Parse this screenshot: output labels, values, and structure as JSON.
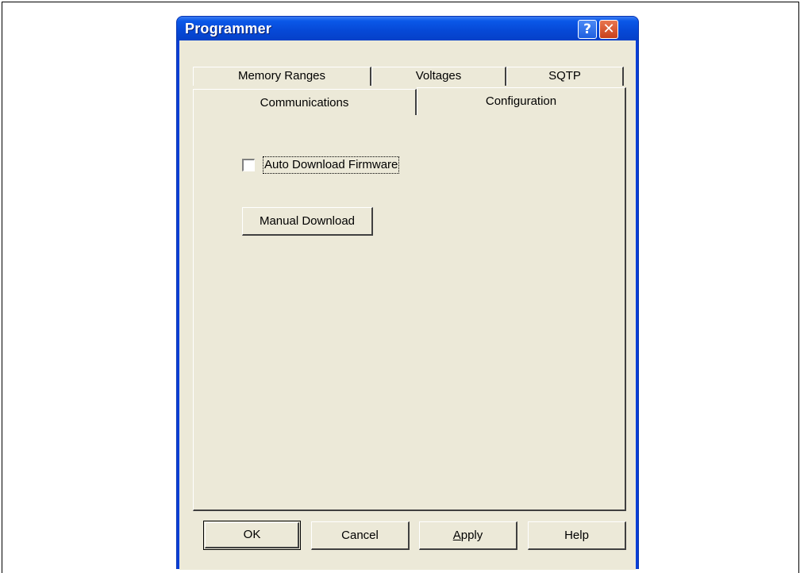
{
  "window": {
    "title": "Programmer",
    "help_glyph": "?",
    "close_glyph": "✕"
  },
  "tabs": {
    "row1": [
      {
        "label": "Memory Ranges"
      },
      {
        "label": "Voltages"
      },
      {
        "label": "SQTP"
      }
    ],
    "row2": [
      {
        "label": "Communications"
      },
      {
        "label": "Configuration",
        "selected": true
      }
    ]
  },
  "config": {
    "auto_download_label": "Auto Download Firmware",
    "auto_download_checked": false,
    "manual_download_label": "Manual Download"
  },
  "buttons": {
    "ok": "OK",
    "cancel": "Cancel",
    "apply_mnemonic": "A",
    "apply_rest": "pply",
    "help": "Help"
  }
}
